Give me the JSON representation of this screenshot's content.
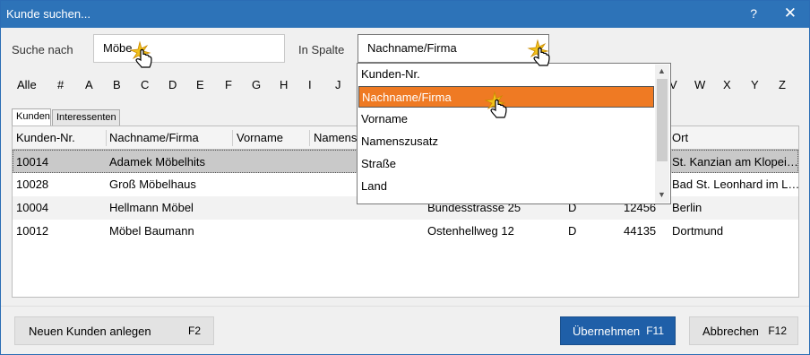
{
  "window": {
    "title": "Kunde suchen...",
    "help_label": "?",
    "close_label": "✕"
  },
  "search": {
    "label": "Suche nach",
    "value": "Möbe",
    "column_label": "In Spalte",
    "column_value": "Nachname/Firma"
  },
  "alphabet": [
    "Alle",
    "#",
    "A",
    "B",
    "C",
    "D",
    "E",
    "F",
    "G",
    "H",
    "I",
    "J",
    "V",
    "W",
    "X",
    "Y",
    "Z"
  ],
  "tabs": [
    "Kunden",
    "Interessenten"
  ],
  "table": {
    "columns": [
      "Kunden-Nr.",
      "Nachname/Firma",
      "Vorname",
      "Namens",
      "Ort"
    ],
    "rows": [
      {
        "nr": "10014",
        "name": "Adamek Möbelhits",
        "street": "",
        "country": "",
        "zip": "",
        "city": "St. Kanzian am Klopei…"
      },
      {
        "nr": "10028",
        "name": "Groß Möbelhaus",
        "street": "",
        "country": "",
        "zip": "",
        "city": "Bad St. Leonhard im L…"
      },
      {
        "nr": "10004",
        "name": "Hellmann Möbel",
        "street": "Bundesstrasse 25",
        "country": "D",
        "zip": "12456",
        "city": "Berlin"
      },
      {
        "nr": "10012",
        "name": "Möbel Baumann",
        "street": "Ostenhellweg 12",
        "country": "D",
        "zip": "44135",
        "city": "Dortmund"
      }
    ]
  },
  "dropdown": {
    "options": [
      "Kunden-Nr.",
      "Nachname/Firma",
      "Vorname",
      "Namenszusatz",
      "Straße",
      "Land"
    ],
    "highlighted": "Nachname/Firma"
  },
  "buttons": {
    "new_customer": "Neuen Kunden anlegen",
    "new_customer_key": "F2",
    "accept": "Übernehmen",
    "accept_key": "F11",
    "cancel": "Abbrechen",
    "cancel_key": "F12"
  },
  "colors": {
    "titlebar": "#2d73b8",
    "highlight": "#ef7a23",
    "primary_button": "#1f5fa8"
  }
}
